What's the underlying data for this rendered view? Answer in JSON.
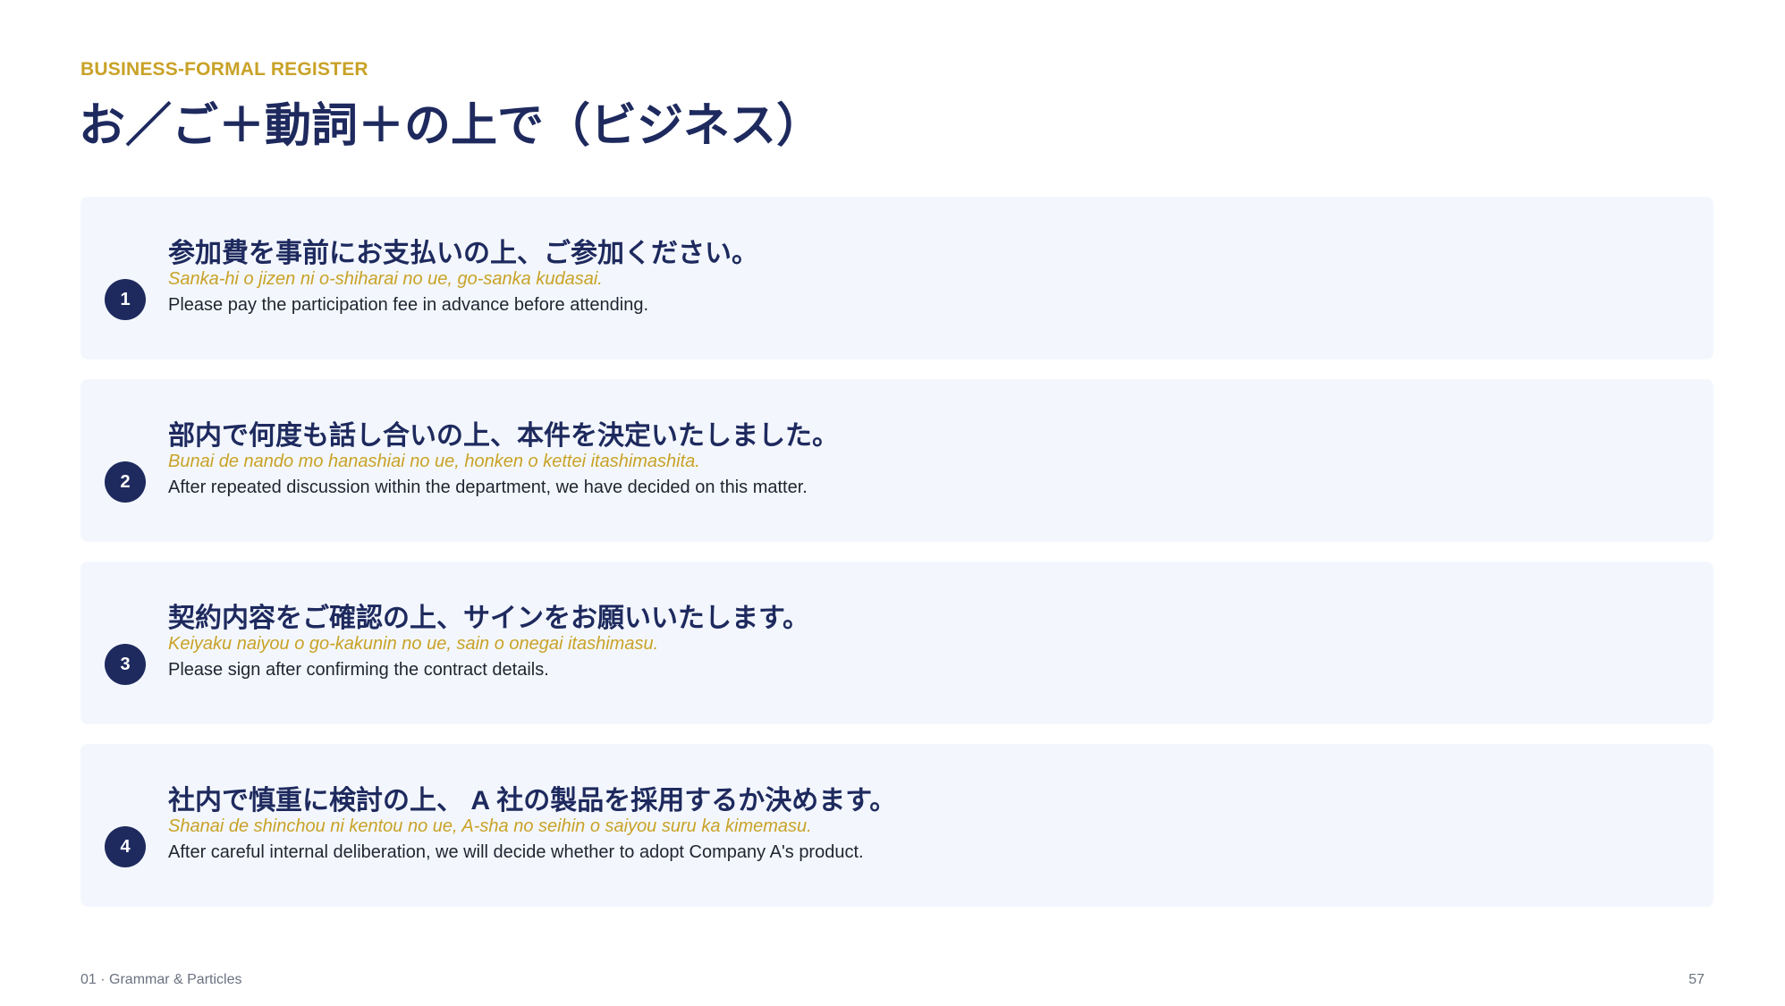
{
  "header": {
    "eyebrow": "BUSINESS-FORMAL REGISTER",
    "title": "お／ご＋動詞＋の上で（ビジネス）"
  },
  "examples": [
    {
      "number": "1",
      "japanese": "参加費を事前にお支払いの上、ご参加ください。",
      "romaji": "Sanka-hi o jizen ni o-shiharai no ue, go-sanka kudasai.",
      "english": "Please pay the participation fee in advance before attending."
    },
    {
      "number": "2",
      "japanese": "部内で何度も話し合いの上、本件を決定いたしました。",
      "romaji": "Bunai de nando mo hanashiai no ue, honken o kettei itashimashita.",
      "english": "After repeated discussion within the department, we have decided on this matter."
    },
    {
      "number": "3",
      "japanese": "契約内容をご確認の上、サインをお願いいたします。",
      "romaji": "Keiyaku naiyou o go-kakunin no ue, sain o onegai itashimasu.",
      "english": "Please sign after confirming the contract details."
    },
    {
      "number": "4",
      "japanese": "社内で慎重に検討の上、 A 社の製品を採用するか決めます。",
      "romaji": "Shanai de shinchou ni kentou no ue, A-sha no seihin o saiyou suru ka kimemasu.",
      "english": "After careful internal deliberation, we will decide whether to adopt Company A's product."
    }
  ],
  "footer": {
    "section": "01 · Grammar & Particles",
    "page_number": "57"
  },
  "colors": {
    "navy": "#1e2a5e",
    "gold": "#c9a227",
    "card_bg": "#f3f7fd"
  }
}
